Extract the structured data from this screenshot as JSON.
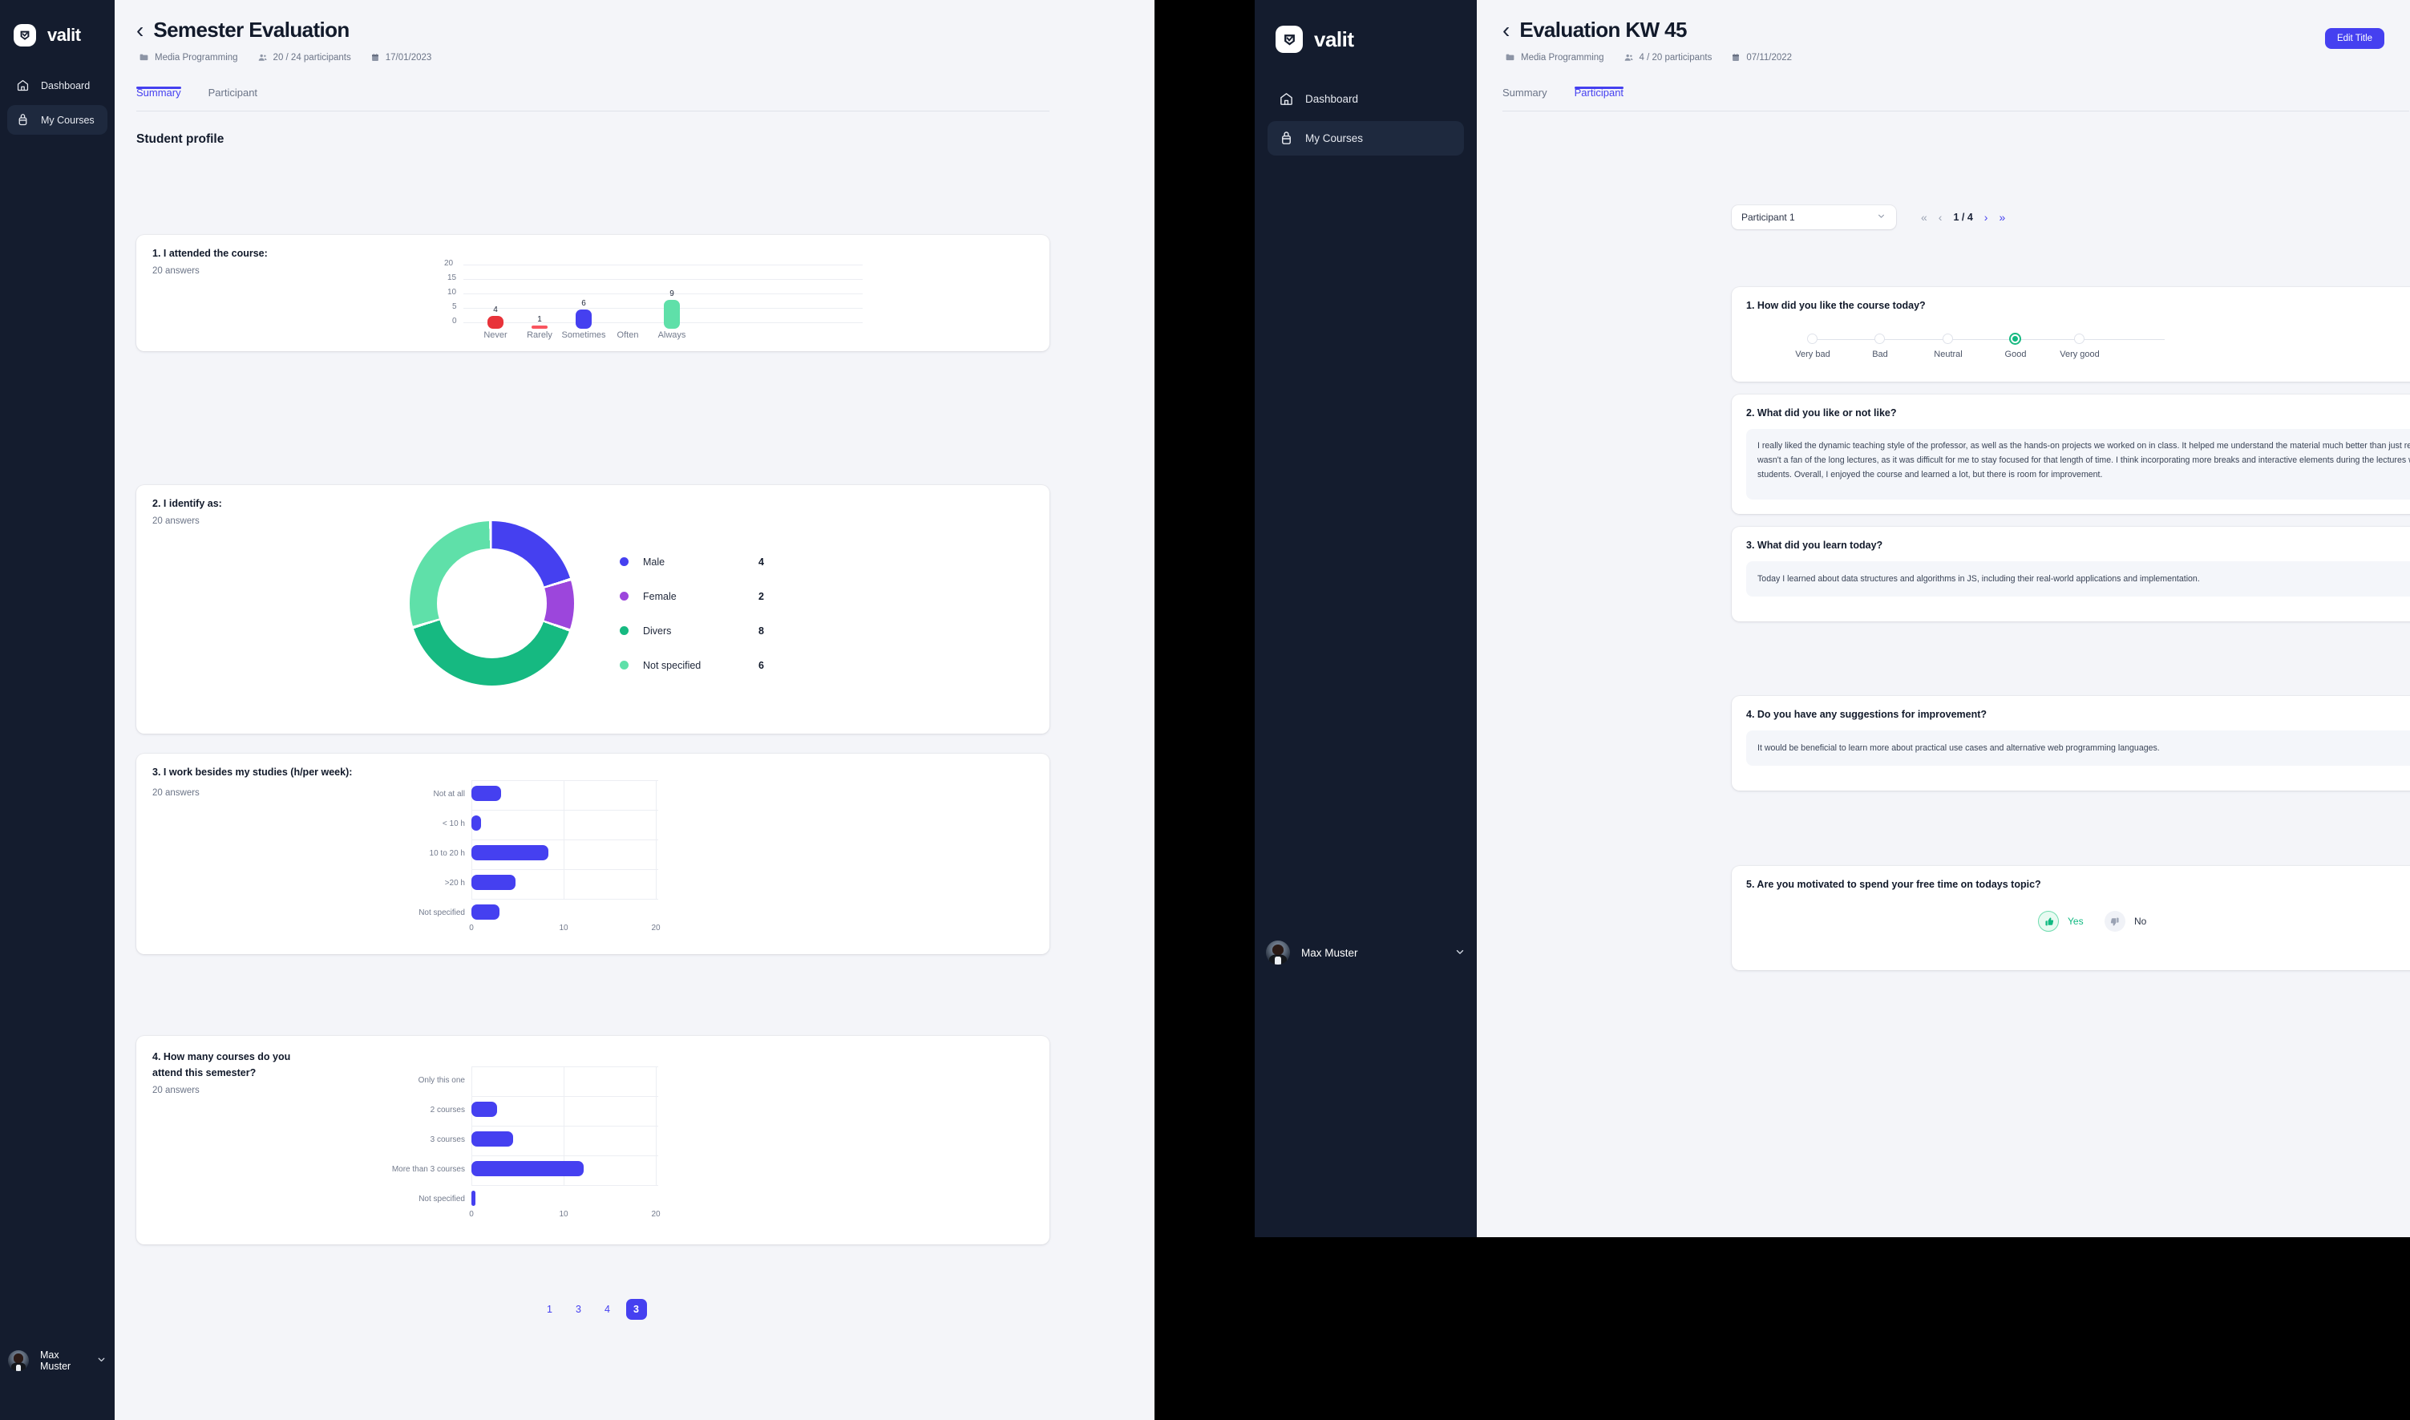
{
  "brand": {
    "word": "valit",
    "mark": "v"
  },
  "sidebar": {
    "items": [
      {
        "label": "Dashboard",
        "icon": "home-icon"
      },
      {
        "label": "My Courses",
        "icon": "courses-icon"
      }
    ],
    "user": {
      "name": "Max Muster"
    }
  },
  "left_window": {
    "header": {
      "back": "‹",
      "title": "Semester Evaluation",
      "meta": {
        "course": "Media Programming",
        "participants": "20 / 24 participants",
        "date": "17/01/2023"
      }
    },
    "tabs": [
      {
        "label": "Summary",
        "active": true
      },
      {
        "label": "Participant",
        "active": false
      }
    ],
    "section_title": "Student profile",
    "pager": {
      "pages": [
        "1",
        "3",
        "4"
      ],
      "active": "3"
    }
  },
  "right_window": {
    "header": {
      "back": "‹",
      "title": "Evaluation KW 45",
      "edit_button": "Edit Title",
      "meta": {
        "course": "Media Programming",
        "participants": "4 / 20 participants",
        "date": "07/11/2022"
      }
    },
    "tabs": [
      {
        "label": "Summary",
        "active": false
      },
      {
        "label": "Participant",
        "active": true
      }
    ],
    "participant_select": {
      "value": "Participant 1",
      "caret": "⌄"
    },
    "pagination": {
      "first": "«",
      "prev": "‹",
      "count": "1 / 4",
      "next": "›",
      "last": "»"
    },
    "questions": {
      "q1": {
        "title": "1. How did you like the course today?",
        "options": [
          "Very bad",
          "Bad",
          "Neutral",
          "Good",
          "Very good"
        ],
        "selected_index": 3
      },
      "q2": {
        "title": "2. What did you like or not like?",
        "answer": "I really liked the dynamic teaching style of the professor, as well as the hands-on projects we worked on in class. It helped me understand the material much better than just reading from a textbook. However, I wasn't a fan of the long lectures, as it was difficult for me to stay focused for that length of time. I think incorporating more breaks and interactive elements during the lectures would be beneficial for all students. Overall, I enjoyed the course and learned a lot, but there is room for improvement."
      },
      "q3": {
        "title": "3. What did you learn today?",
        "answer": "Today I learned about data structures and algorithms in JS, including their real-world applications and implementation."
      },
      "q4": {
        "title": "4. Do you have any suggestions for improvement?",
        "answer": "It would be beneficial to learn more about practical use cases and alternative web programming languages."
      },
      "q5": {
        "title": "5. Are you motivated to spend your free time on todays topic?",
        "yes_label": "Yes",
        "no_label": "No",
        "selected": "Yes"
      }
    }
  },
  "colors": {
    "accent": "#4540f0",
    "green": "#10b981",
    "bar_blue": "#4540f0",
    "red": "#e8333a",
    "red_light": "#f9555f",
    "donut_male": "#4540f0",
    "donut_female": "#9c46dc",
    "donut_divers": "#16b981",
    "donut_notspec": "#5fe0a9"
  },
  "chart_data": [
    {
      "type": "bar",
      "title": "1. I attended the course:",
      "subtitle": "20 answers",
      "categories": [
        "Never",
        "Rarely",
        "Sometimes",
        "Often",
        "Always"
      ],
      "values": [
        4,
        1,
        6,
        0,
        9
      ],
      "colors": [
        "#e8333a",
        "#f9555f",
        "#4540f0",
        "#4540f0",
        "#5fe0a9"
      ],
      "ylim": [
        0,
        20
      ],
      "yticks": [
        0,
        5,
        10,
        15,
        20
      ],
      "xlabel": "",
      "ylabel": "",
      "grid": true,
      "data_labels": true
    },
    {
      "type": "pie",
      "title": "2. I identify as:",
      "subtitle": "20 answers",
      "categories": [
        "Male",
        "Female",
        "Divers",
        "Not specified"
      ],
      "values": [
        4,
        2,
        8,
        6
      ],
      "colors": [
        "#4540f0",
        "#9c46dc",
        "#16b981",
        "#5fe0a9"
      ],
      "legend": "right",
      "donut": true
    },
    {
      "type": "bar",
      "orientation": "horizontal",
      "title": "3. I work besides my studies (h/per week):",
      "subtitle": "20 answers",
      "categories": [
        "Not at all",
        "< 10 h",
        "10 to 20 h",
        ">20 h",
        "Not specified"
      ],
      "values": [
        3.2,
        1.0,
        8.3,
        4.8,
        3.0
      ],
      "color": "#4540f0",
      "xlim": [
        0,
        20
      ],
      "xticks": [
        0,
        10,
        20
      ],
      "grid": true
    },
    {
      "type": "bar",
      "orientation": "horizontal",
      "title": "4. How many courses do you attend this semester?",
      "subtitle": "20 answers",
      "categories": [
        "Only this one",
        "2 courses",
        "3 courses",
        "More than 3 courses",
        "Not specified"
      ],
      "values": [
        0,
        2.7,
        4.5,
        12.1,
        0.15
      ],
      "color": "#4540f0",
      "xlim": [
        0,
        20
      ],
      "xticks": [
        0,
        10,
        20
      ],
      "grid": true
    }
  ]
}
